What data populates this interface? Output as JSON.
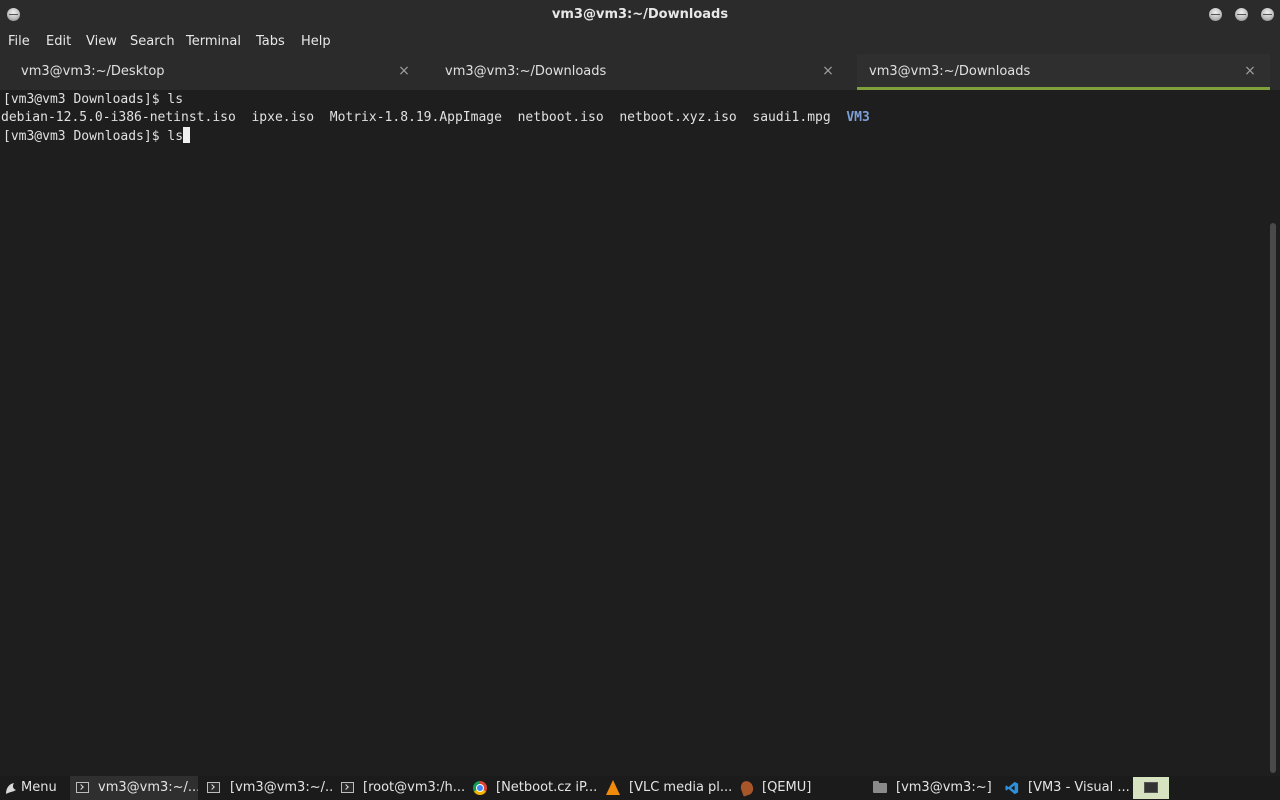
{
  "window": {
    "title": "vm3@vm3:~/Downloads"
  },
  "menu": [
    "File",
    "Edit",
    "View",
    "Search",
    "Terminal",
    "Tabs",
    "Help"
  ],
  "tabs": [
    {
      "label": "vm3@vm3:~/Desktop",
      "active": false
    },
    {
      "label": "vm3@vm3:~/Downloads",
      "active": false
    },
    {
      "label": "vm3@vm3:~/Downloads",
      "active": true
    }
  ],
  "tab_close_glyph": "×",
  "terminal": {
    "prompt": "[vm3@vm3 Downloads]$ ",
    "first_command": "ls",
    "files": [
      "debian-12.5.0-i386-netinst.iso",
      "ipxe.iso",
      "Motrix-1.8.19.AppImage",
      "netboot.iso",
      "netboot.xyz.iso",
      "saudi1.mpg"
    ],
    "dir_entry": "VM3",
    "current_command": "ls"
  },
  "taskbar": {
    "menu_label": "Menu",
    "items": [
      {
        "label": "vm3@vm3:~/...",
        "icon": "terminal-icon",
        "active": true
      },
      {
        "label": "[vm3@vm3:~/...",
        "icon": "terminal-icon",
        "active": false
      },
      {
        "label": "[root@vm3:/h...",
        "icon": "terminal-icon",
        "active": false
      },
      {
        "label": "[Netboot.cz iP...",
        "icon": "chrome-icon",
        "active": false
      },
      {
        "label": "[VLC media pl...",
        "icon": "vlc-icon",
        "active": false
      },
      {
        "label": "[QEMU]",
        "icon": "qemu-icon",
        "active": false
      },
      {
        "label": "[vm3@vm3:~]",
        "icon": "folder-icon",
        "active": false
      },
      {
        "label": "[VM3 - Visual ...",
        "icon": "vscode-icon",
        "active": false
      }
    ]
  },
  "colors": {
    "active_tab_accent": "#7fa03a",
    "directory_text": "#7c9fd6",
    "terminal_bg": "#1e1e1e"
  }
}
